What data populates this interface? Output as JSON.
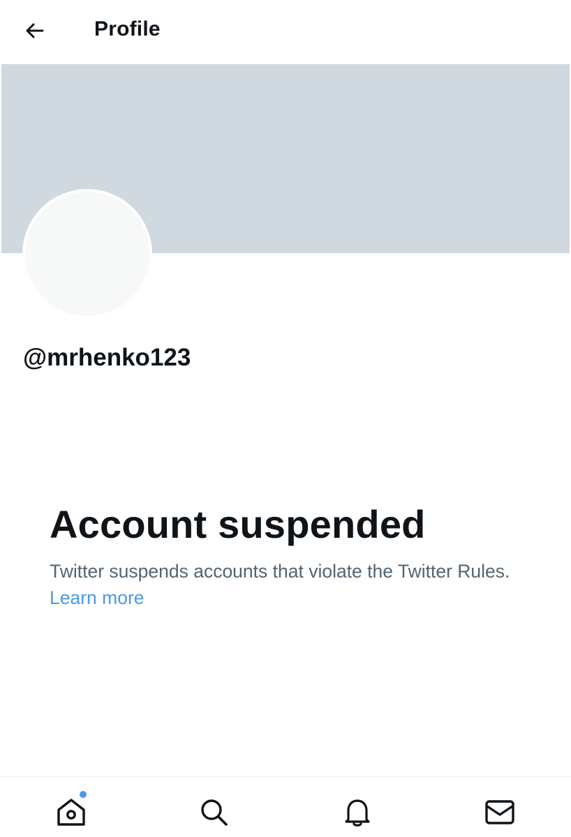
{
  "header": {
    "title": "Profile",
    "back_icon": "arrow-left-icon"
  },
  "profile": {
    "handle": "@mrhenko123",
    "banner_color": "#cfd9df",
    "avatar_color": "#f7f9f9"
  },
  "suspension": {
    "title": "Account suspended",
    "body": "Twitter suspends accounts that violate the Twitter Rules.",
    "link": "Learn more"
  },
  "bottom_nav": {
    "items": [
      {
        "icon": "home-icon",
        "has_notification_dot": true
      },
      {
        "icon": "search-icon"
      },
      {
        "icon": "bell-icon"
      },
      {
        "icon": "mail-icon"
      }
    ],
    "dot_color": "#4a99e9"
  }
}
